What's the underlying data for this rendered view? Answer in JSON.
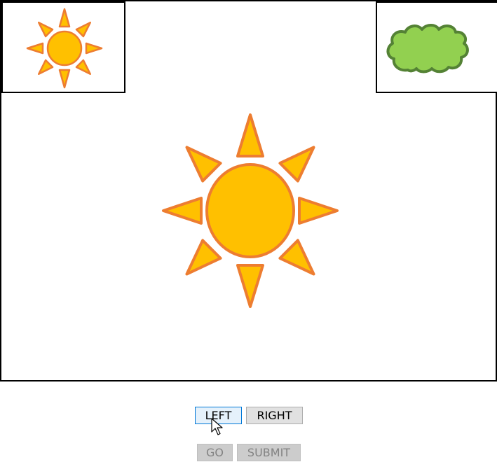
{
  "buttons": {
    "left_label": "LEFT",
    "right_label": "RIGHT",
    "go_label": "GO",
    "submit_label": "SUBMIT"
  },
  "icons": {
    "top_left": "sun-icon",
    "top_right": "cloud-icon",
    "center": "sun-icon"
  },
  "colors": {
    "sun_fill": "#FFC000",
    "sun_stroke": "#ED7D31",
    "cloud_fill": "#92D050",
    "cloud_stroke": "#548235"
  }
}
